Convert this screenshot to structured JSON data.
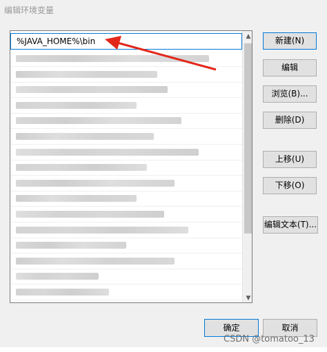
{
  "dialog": {
    "title": "编辑环境变量"
  },
  "list": {
    "selected": "%JAVA_HOME%\\bin",
    "rows": [
      {
        "label": ""
      },
      {
        "label": ""
      },
      {
        "label": ""
      },
      {
        "label": ""
      },
      {
        "label": ""
      },
      {
        "label": ""
      },
      {
        "label": ""
      },
      {
        "label": ""
      },
      {
        "label": ""
      },
      {
        "label": ""
      },
      {
        "label": ""
      },
      {
        "label": ""
      },
      {
        "label": ""
      },
      {
        "label": ""
      },
      {
        "label": ""
      },
      {
        "label": ""
      }
    ]
  },
  "buttons": {
    "new": "新建(N)",
    "edit": "编辑",
    "browse": "浏览(B)...",
    "delete": "删除(D)",
    "move_up": "上移(U)",
    "move_down": "下移(O)",
    "edit_text": "编辑文本(T)..."
  },
  "footer": {
    "ok": "确定",
    "cancel": "取消"
  },
  "watermark": "CSDN @tomatoo_13",
  "colors": {
    "arrow": "#e2281b",
    "selection": "#0078d7"
  }
}
